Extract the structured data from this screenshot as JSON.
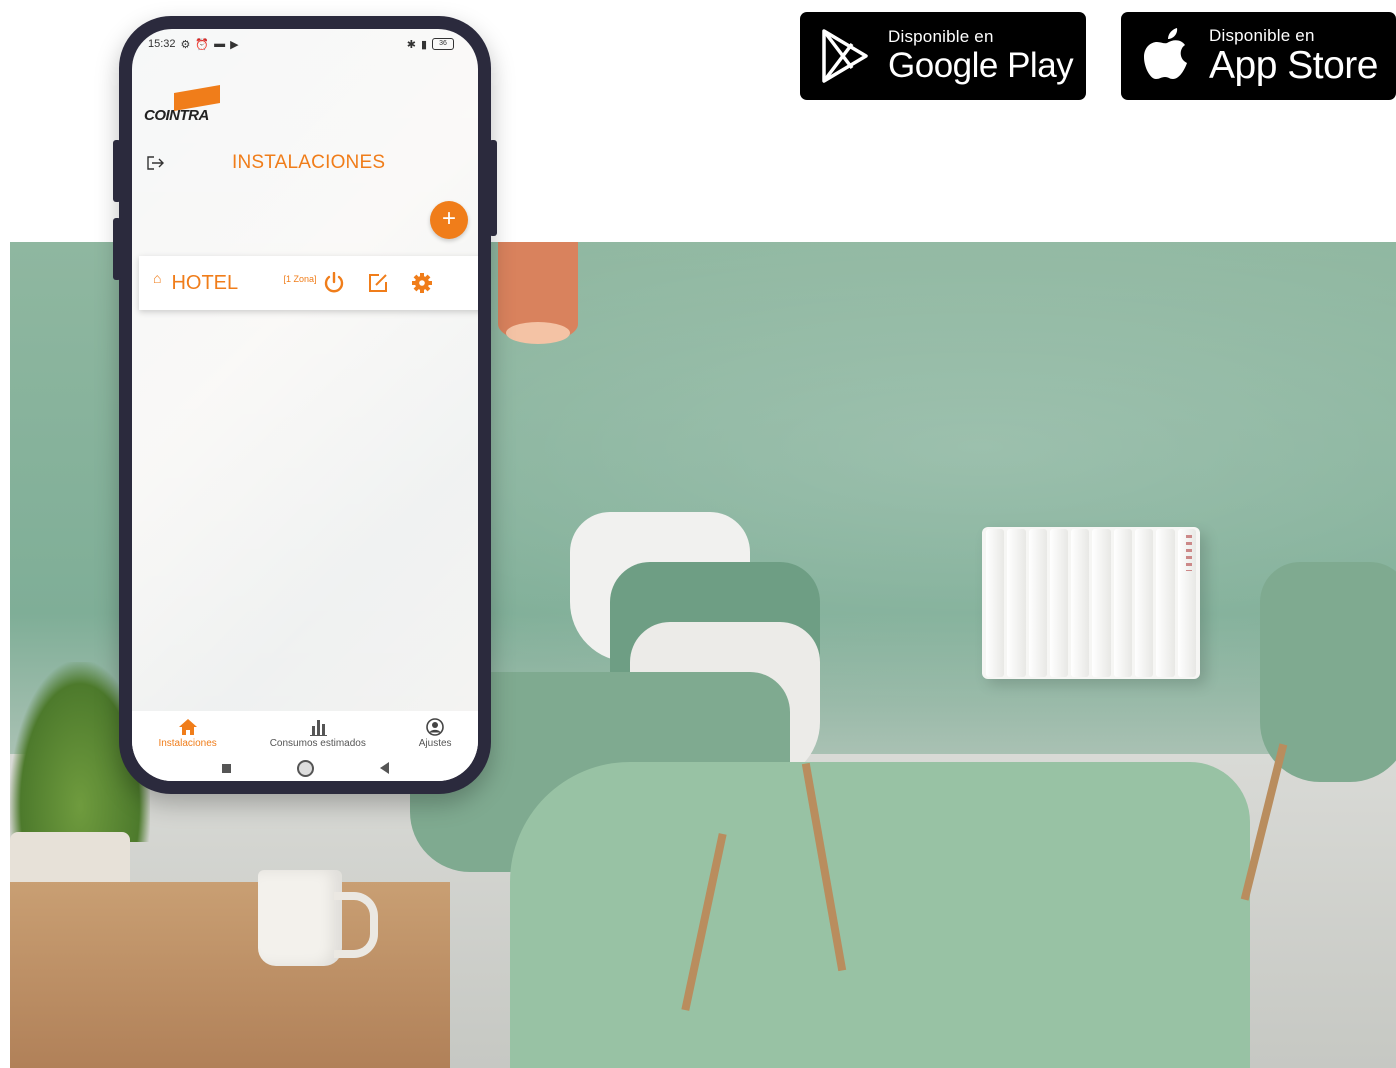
{
  "colors": {
    "accent": "#f07d1a",
    "phone_frame": "#2b2a3d",
    "badge_bg": "#000000"
  },
  "badges": {
    "google": {
      "small": "Disponible en",
      "big": "Google Play",
      "icon": "google-play-icon"
    },
    "apple": {
      "small": "Disponible en",
      "big": "App Store",
      "icon": "apple-icon"
    }
  },
  "phone": {
    "status_bar": {
      "time": "15:32",
      "battery": "36"
    },
    "logo_text": "COINTRA",
    "page_title": "INSTALACIONES",
    "fab_label": "+",
    "installation": {
      "name": "HOTEL",
      "zones": "[1 Zona]"
    },
    "bottom_nav": [
      {
        "label": "Instalaciones",
        "icon": "home-icon",
        "active": true
      },
      {
        "label": "Consumos estimados",
        "icon": "bar-chart-icon",
        "active": false
      },
      {
        "label": "Ajustes",
        "icon": "user-circle-icon",
        "active": false
      }
    ]
  }
}
